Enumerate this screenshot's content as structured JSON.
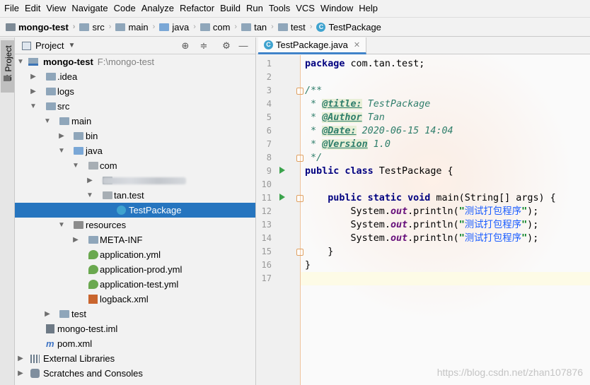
{
  "menu": [
    "File",
    "Edit",
    "View",
    "Navigate",
    "Code",
    "Analyze",
    "Refactor",
    "Build",
    "Run",
    "Tools",
    "VCS",
    "Window",
    "Help"
  ],
  "breadcrumb": {
    "project": "mongo-test",
    "parts": [
      "src",
      "main",
      "java",
      "com",
      "tan",
      "test"
    ],
    "file": "TestPackage"
  },
  "toolstrip": {
    "project_tab": "1: Project"
  },
  "project_panel": {
    "title": "Project",
    "tree": {
      "root": "mongo-test",
      "root_path": "F:\\mongo-test",
      "idea": ".idea",
      "logs": "logs",
      "src": "src",
      "main": "main",
      "bin": "bin",
      "java": "java",
      "com": "com",
      "tan_test": "tan.test",
      "test_package": "TestPackage",
      "resources": "resources",
      "meta_inf": "META-INF",
      "app_yml": "application.yml",
      "app_prod_yml": "application-prod.yml",
      "app_test_yml": "application-test.yml",
      "logback": "logback.xml",
      "test": "test",
      "iml": "mongo-test.iml",
      "pom": "pom.xml",
      "ext_libs": "External Libraries",
      "scratches": "Scratches and Consoles"
    }
  },
  "editor": {
    "tab_label": "TestPackage.java",
    "line_numbers": [
      "1",
      "2",
      "3",
      "4",
      "5",
      "6",
      "7",
      "8",
      "9",
      "10",
      "11",
      "12",
      "13",
      "14",
      "15",
      "16",
      "17"
    ],
    "code": {
      "l1_kw": "package",
      "l1_rest": " com.tan.test;",
      "l3": "/**",
      "l4_pre": " * ",
      "l4_tag": "@title:",
      "l4_val": " TestPackage",
      "l5_pre": " * ",
      "l5_tag": "@Author",
      "l5_val": " Tan",
      "l6_pre": " * ",
      "l6_tag": "@Date:",
      "l6_val": " 2020-06-15 14:04",
      "l7_pre": " * ",
      "l7_tag": "@Version",
      "l7_val": " 1.0",
      "l8": " */",
      "l9_kw": "public class",
      "l9_rest": " TestPackage {",
      "l11_indent": "    ",
      "l11_kw": "public static void",
      "l11_rest": " main(String[] args) {",
      "print_pre": "        System.",
      "print_out": "out",
      "print_mid": ".println(",
      "print_str_q1": "\"",
      "print_str_cn": "测试打包程序",
      "print_str_q2": "\"",
      "print_end": ");",
      "l15": "    }",
      "l16": "}"
    }
  },
  "watermark": "https://blog.csdn.net/zhan107876"
}
